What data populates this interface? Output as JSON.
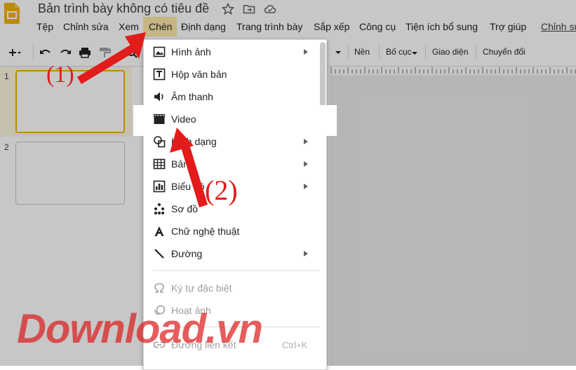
{
  "window": {
    "doc_title": "Bản trình bày không có tiêu đề",
    "last_edit_link": "Chỉnh sửa"
  },
  "menubar": {
    "items": [
      "Tệp",
      "Chỉnh sửa",
      "Xem",
      "Chèn",
      "Định dạng",
      "Trang trình bày",
      "Sắp xếp",
      "Công cụ",
      "Tiện ích bổ sung",
      "Trợ giúp"
    ]
  },
  "toolbar": {
    "background_label": "Nền",
    "layout_label": "Bố cục",
    "theme_label": "Giao diện",
    "transition_label": "Chuyển đổi"
  },
  "slides": {
    "numbers": [
      "1",
      "2"
    ]
  },
  "insert_menu": {
    "items": [
      {
        "label": "Hình ảnh",
        "icon": "image-icon",
        "submenu": true,
        "disabled": false
      },
      {
        "label": "Hộp văn bản",
        "icon": "text-box-icon",
        "submenu": false,
        "disabled": false
      },
      {
        "label": "Âm thanh",
        "icon": "audio-icon",
        "submenu": false,
        "disabled": false
      },
      {
        "label": "Video",
        "icon": "video-icon",
        "submenu": false,
        "disabled": false
      },
      {
        "label": "Hình dạng",
        "icon": "shape-icon",
        "submenu": true,
        "disabled": false
      },
      {
        "label": "Bảng",
        "icon": "table-icon",
        "submenu": true,
        "disabled": false
      },
      {
        "label": "Biểu đồ",
        "icon": "chart-icon",
        "submenu": true,
        "disabled": false
      },
      {
        "label": "Sơ đồ",
        "icon": "diagram-icon",
        "submenu": false,
        "disabled": false
      },
      {
        "label": "Chữ nghệ thuật",
        "icon": "word-art-icon",
        "submenu": false,
        "disabled": false
      },
      {
        "label": "Đường",
        "icon": "line-icon",
        "submenu": true,
        "disabled": false
      },
      {
        "label": "Ký tự đặc biệt",
        "icon": "omega-icon",
        "submenu": false,
        "disabled": true
      },
      {
        "label": "Hoạt ảnh",
        "icon": "animation-icon",
        "submenu": false,
        "disabled": true
      },
      {
        "label": "Đường liên kết",
        "icon": "link-icon",
        "submenu": false,
        "disabled": true
      }
    ],
    "link_shortcut": "Ctrl+K"
  },
  "annotations": {
    "step1": "(1)",
    "step2": "(2)",
    "arrow_color": "#e21b1b"
  },
  "watermark": {
    "text": "Download.vn"
  },
  "colors": {
    "accent_yellow": "#f4b400",
    "menu_highlight": "#fde9a8"
  }
}
